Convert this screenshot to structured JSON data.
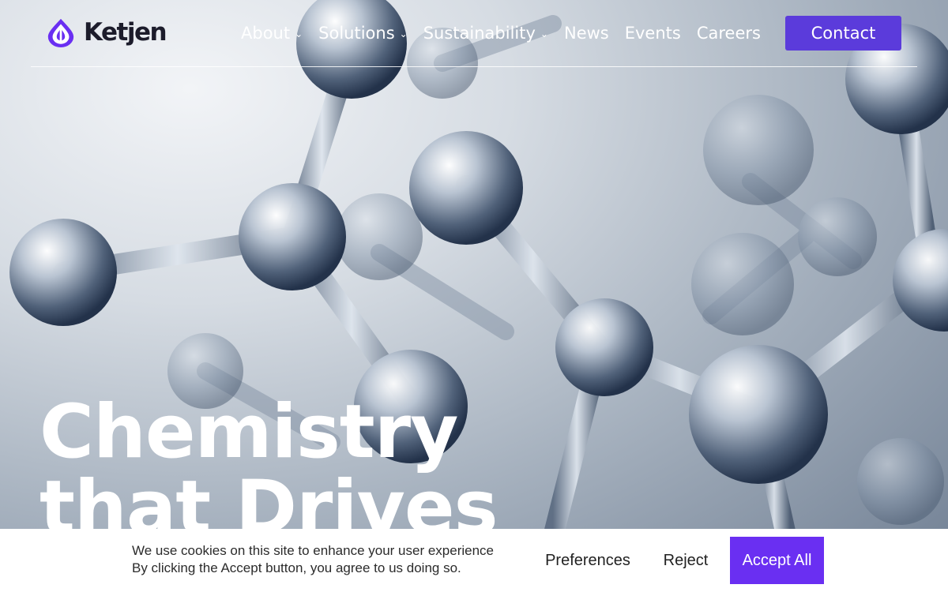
{
  "brand": {
    "name": "Ketjen",
    "accent": "#6a2ff2",
    "contact_color": "#5b3bdb"
  },
  "nav": {
    "items": [
      {
        "label": "About",
        "has_dropdown": true,
        "icon": "chevron-down-icon"
      },
      {
        "label": "Solutions",
        "has_dropdown": true,
        "icon": "chevron-down-icon"
      },
      {
        "label": "Sustainability",
        "has_dropdown": true,
        "icon": "chevron-down-icon"
      },
      {
        "label": "News",
        "has_dropdown": false
      },
      {
        "label": "Events",
        "has_dropdown": false
      },
      {
        "label": "Careers",
        "has_dropdown": false
      }
    ],
    "contact_label": "Contact"
  },
  "hero": {
    "title_line1": "Chemistry",
    "title_line2": "that Drives"
  },
  "cookie": {
    "line1": "We use cookies on this site to enhance your user experience",
    "line2": "By clicking the Accept button, you agree to us doing so.",
    "preferences_label": "Preferences",
    "reject_label": "Reject",
    "accept_label": "Accept All"
  }
}
